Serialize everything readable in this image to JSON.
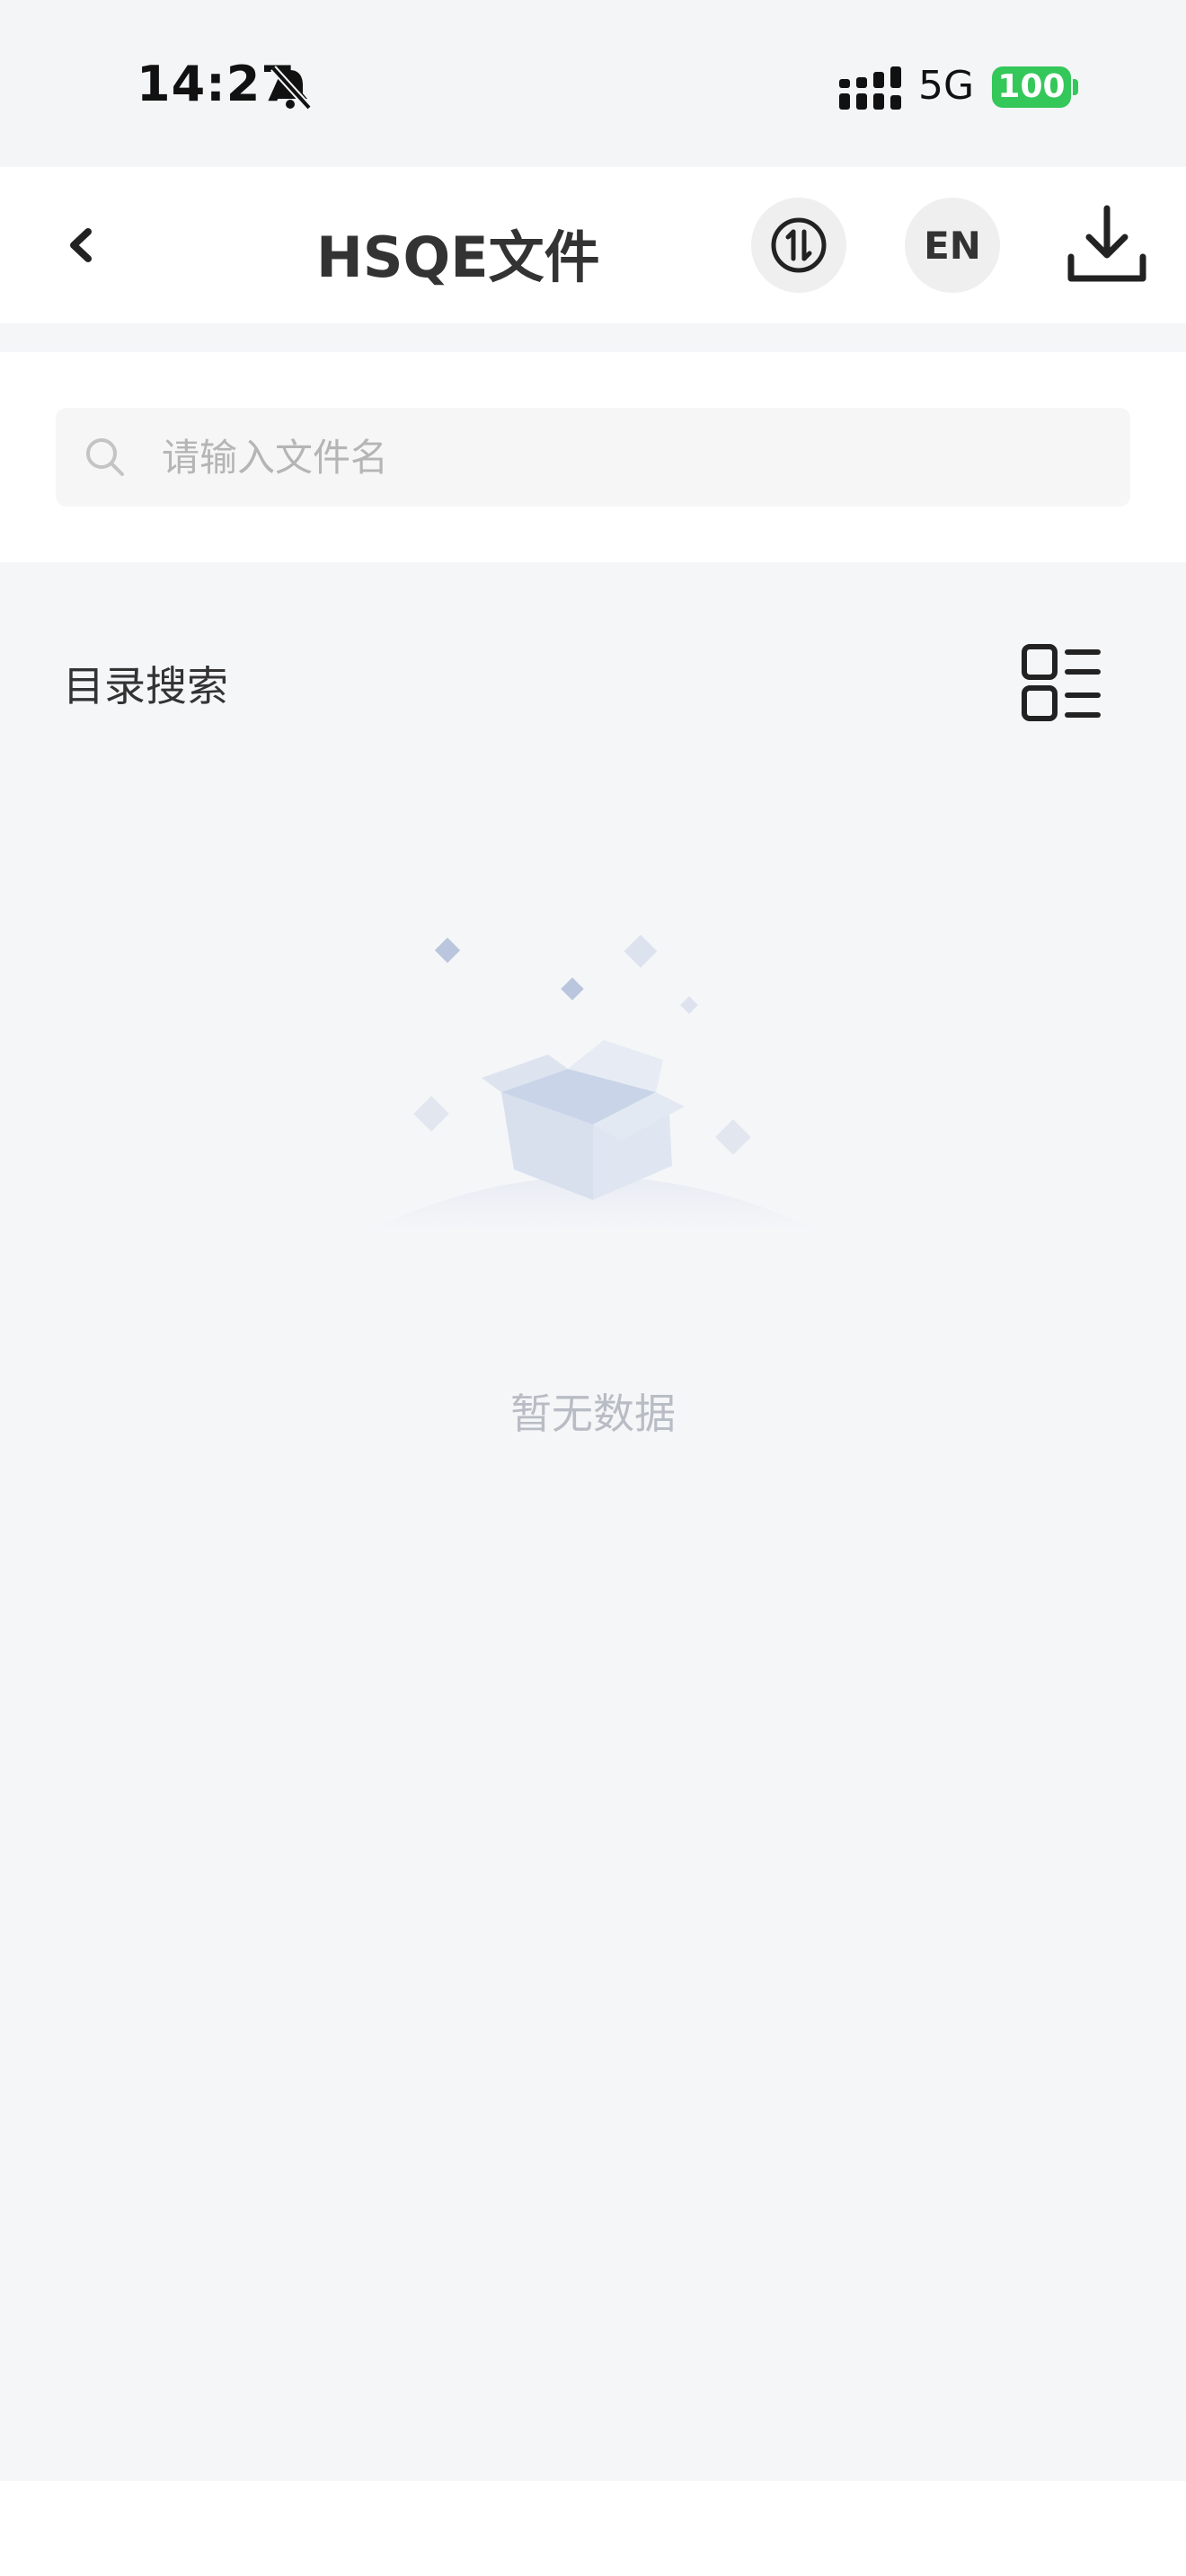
{
  "status_bar": {
    "time": "14:27",
    "network": "5G",
    "battery": "100",
    "icons": [
      "bell-slash-icon",
      "signal-icon"
    ],
    "battery_color": "#34c759"
  },
  "nav": {
    "title": "HSQE文件",
    "lang_button": "EN",
    "icons": [
      "back-chevron-icon",
      "sort-swap-icon",
      "download-icon"
    ]
  },
  "search": {
    "placeholder": "请输入文件名",
    "value": ""
  },
  "directory": {
    "label": "目录搜索",
    "view_icon": "list-grid-icon"
  },
  "empty_state": {
    "message": "暂无数据",
    "icon": "empty-box-icon"
  },
  "colors": {
    "page_background": "#f5f6f8",
    "card_background": "#ffffff",
    "muted_text": "#b8bcc4"
  }
}
